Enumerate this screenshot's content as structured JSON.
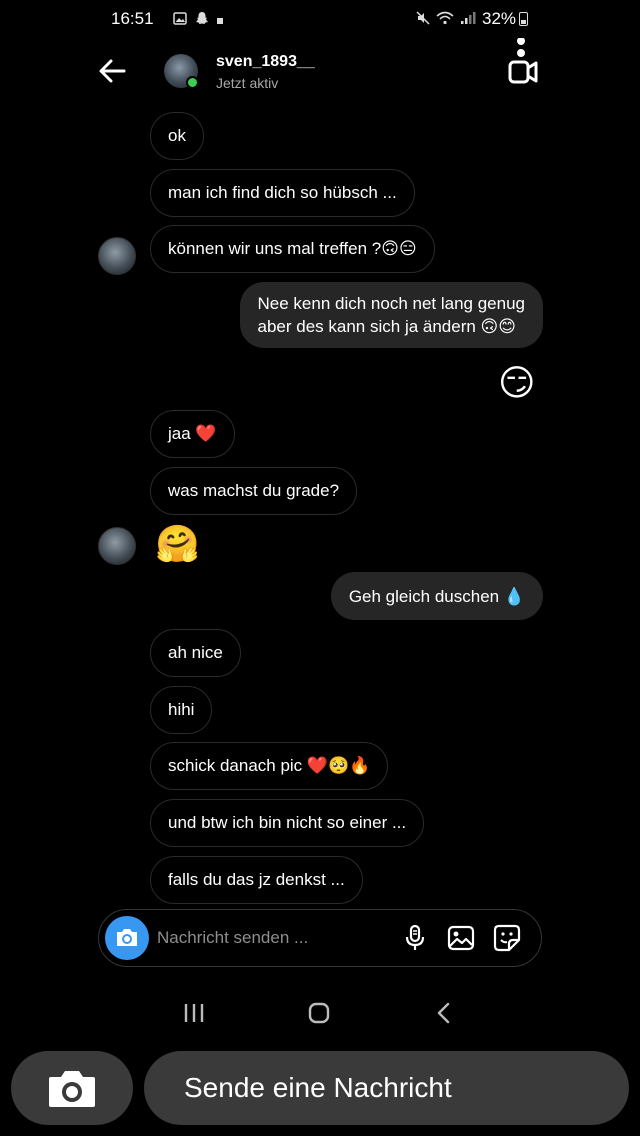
{
  "status_bar": {
    "time": "16:51",
    "battery": "32%"
  },
  "header": {
    "username": "sven_1893__",
    "status": "Jetzt aktiv"
  },
  "messages": [
    {
      "side": "in",
      "text": "ok"
    },
    {
      "side": "in",
      "text": "man ich find dich so hübsch ..."
    },
    {
      "side": "in",
      "text": "können wir uns mal treffen ?🙃😑",
      "avatar": true
    },
    {
      "side": "out",
      "text_line1": "Nee kenn dich noch net lang genug",
      "text_line2": "aber des kann sich ja ändern 🙃😊"
    },
    {
      "side": "out",
      "emoji": "😏"
    },
    {
      "side": "in",
      "text": "jaa ❤️"
    },
    {
      "side": "in",
      "text": "was machst du grade?"
    },
    {
      "side": "in",
      "emoji": "🤗",
      "avatar": true
    },
    {
      "side": "out",
      "text": "Geh gleich duschen 💧"
    },
    {
      "side": "in",
      "text": "ah nice"
    },
    {
      "side": "in",
      "text": "hihi"
    },
    {
      "side": "in",
      "text": "schick danach pic ❤️🥺🔥"
    },
    {
      "side": "in",
      "text": "und btw ich bin nicht so einer ..."
    },
    {
      "side": "in",
      "text": "falls du das jz denkst ..."
    }
  ],
  "composer": {
    "placeholder": "Nachricht senden ..."
  },
  "snap_bar": {
    "send_label": "Sende eine Nachricht"
  },
  "colors": {
    "accent": "#3897f0",
    "online": "#3cce53",
    "outgoing_bubble": "#262626",
    "snap_bar_bg": "#3a3a3a"
  },
  "icons": {
    "back": "arrow-left-icon",
    "video": "video-call-icon",
    "camera": "camera-icon",
    "mic": "microphone-icon",
    "gallery": "image-icon",
    "sticker": "sticker-icon"
  }
}
